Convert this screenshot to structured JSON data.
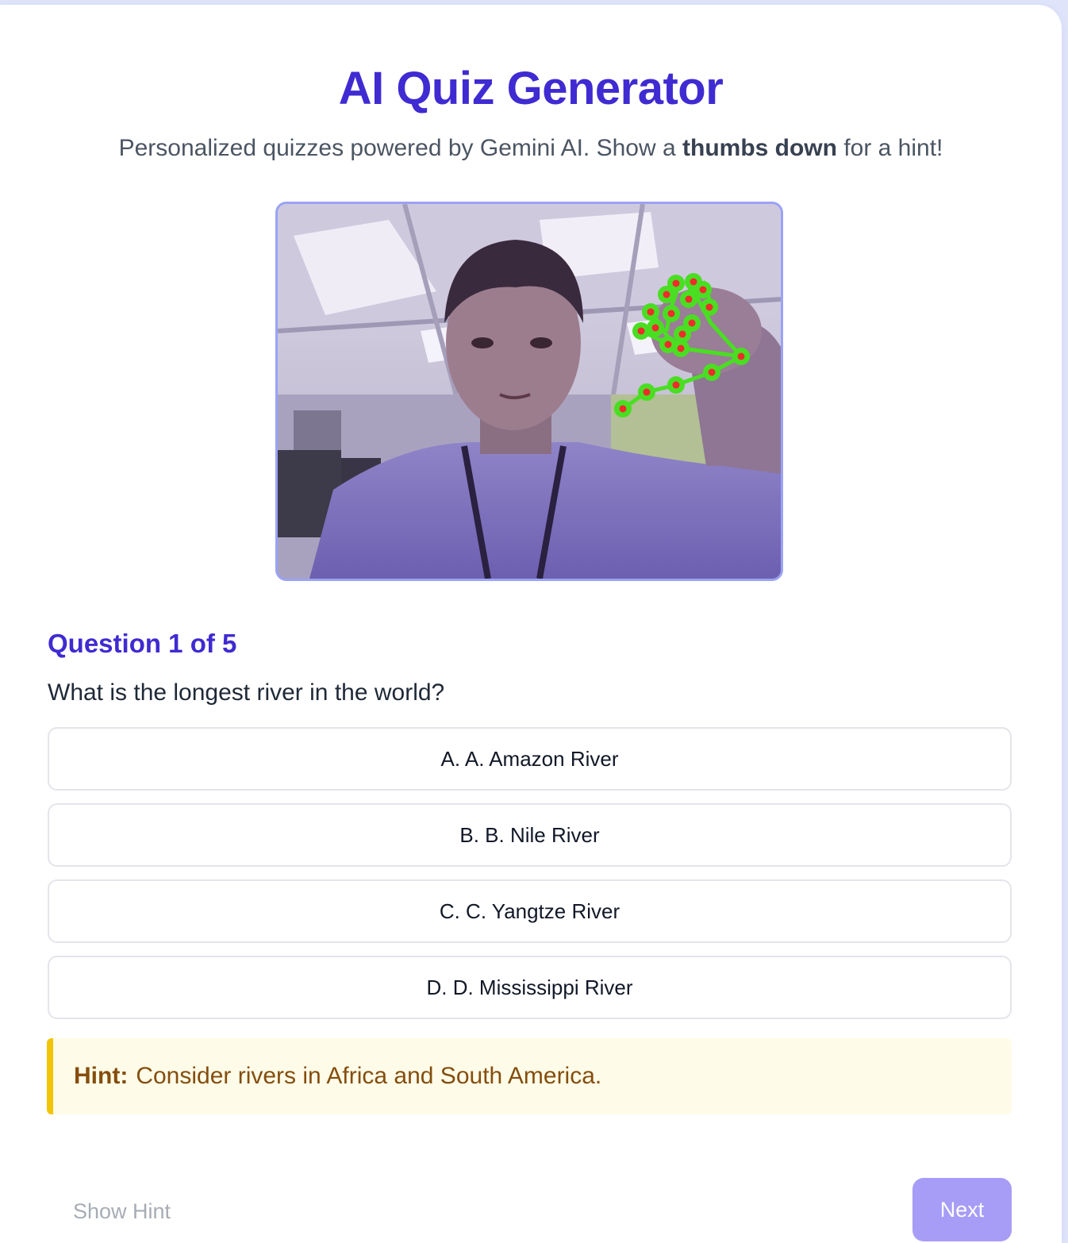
{
  "header": {
    "title": "AI Quiz Generator",
    "subtitle_pre": "Personalized quizzes powered by Gemini AI. Show a ",
    "subtitle_bold": "thumbs down",
    "subtitle_post": " for a hint!"
  },
  "camera": {
    "description_icon": "webcam-feed-with-hand-landmarks",
    "landmark_line_color": "#4ade23",
    "landmark_point_color": "#ef2b2b"
  },
  "quiz": {
    "counter": "Question 1 of 5",
    "question": "What is the longest river in the world?",
    "options": [
      "A. A. Amazon River",
      "B. B. Nile River",
      "C. C. Yangtze River",
      "D. D. Mississippi River"
    ]
  },
  "hint": {
    "label": "Hint:",
    "text": "Consider rivers in Africa and South America."
  },
  "actions": {
    "show_hint": "Show Hint",
    "next": "Next"
  },
  "colors": {
    "accent": "#3f2bd1",
    "next_button": "#a79cf6",
    "hint_border": "#f2c409",
    "hint_background": "#fefce8"
  }
}
